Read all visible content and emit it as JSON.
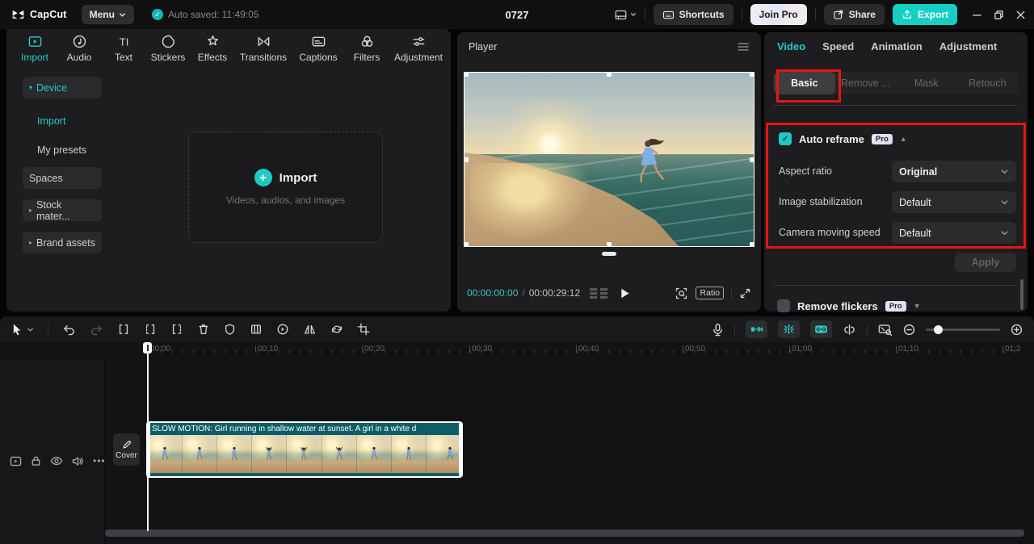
{
  "colors": {
    "accent": "#25cbc6",
    "export_teal": "#16cfc4",
    "annotation_red": "#e81414",
    "clip_teal": "#0d5e64"
  },
  "titlebar": {
    "app_name": "CapCut",
    "menu": "Menu",
    "autosave": "Auto saved: 11:49:05",
    "project_title": "0727",
    "shortcuts": "Shortcuts",
    "join_pro": "Join Pro",
    "share": "Share",
    "export": "Export"
  },
  "media_panel": {
    "toolbar": [
      {
        "label": "Import"
      },
      {
        "label": "Audio"
      },
      {
        "label": "Text"
      },
      {
        "label": "Stickers"
      },
      {
        "label": "Effects"
      },
      {
        "label": "Transitions"
      },
      {
        "label": "Captions"
      },
      {
        "label": "Filters"
      },
      {
        "label": "Adjustment"
      }
    ],
    "sidebar": [
      {
        "label": "Device"
      },
      {
        "label": "Import"
      },
      {
        "label": "My presets"
      },
      {
        "label": "Spaces"
      },
      {
        "label": "Stock mater..."
      },
      {
        "label": "Brand assets"
      }
    ],
    "dropzone": {
      "title": "Import",
      "subtitle": "Videos, audios, and images"
    }
  },
  "player": {
    "title": "Player",
    "current_time": "00:00:00:00",
    "separator": "/",
    "duration": "00:00:29:12",
    "ratio": "Ratio"
  },
  "inspector": {
    "tabs": [
      {
        "label": "Video"
      },
      {
        "label": "Speed"
      },
      {
        "label": "Animation"
      },
      {
        "label": "Adjustment"
      }
    ],
    "subtabs": [
      {
        "label": "Basic"
      },
      {
        "label": "Remove ..."
      },
      {
        "label": "Mask"
      },
      {
        "label": "Retouch"
      }
    ],
    "auto_reframe": {
      "title": "Auto reframe",
      "pro": "Pro",
      "fields": [
        {
          "label": "Aspect ratio",
          "value": "Original"
        },
        {
          "label": "Image stabilization",
          "value": "Default"
        },
        {
          "label": "Camera moving speed",
          "value": "Default"
        }
      ],
      "apply": "Apply"
    },
    "remove_flickers": {
      "title": "Remove flickers",
      "pro": "Pro"
    }
  },
  "timeline": {
    "ruler": [
      "00:00",
      "00:10",
      "00:20",
      "00:30",
      "00:40",
      "00:50",
      "01:00",
      "01:10",
      "01:2"
    ],
    "cover": "Cover",
    "clip_caption": "SLOW MOTION: Girl running in shallow water at sunset. A girl in a white d"
  }
}
